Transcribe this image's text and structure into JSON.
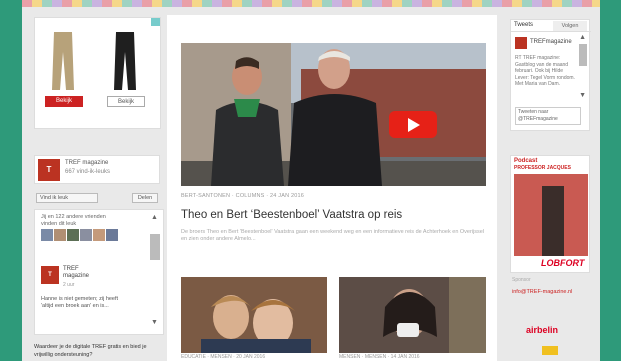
{
  "left": {
    "ad": {
      "products": [
        {
          "button": "Bekijk"
        },
        {
          "button": "Bekijk"
        }
      ]
    },
    "fb": {
      "name": "TREF magazine",
      "likes_text": "667 vind-ik-leuks"
    },
    "like_button": "Vind ik leuk",
    "share_button": "Delen",
    "fanbox": {
      "count_text": "Jij en 122 andere vrienden vinden dit leuk",
      "post_name": "TREF magazine",
      "post_time": "2 uur",
      "post_body": "Hanne is niet gemeten; zij heeft 'altijd een broek aan' en is..."
    },
    "question": "Waardeer je de digitale TREF gratis en bied je vrijwillig ondersteuning?"
  },
  "main": {
    "featured": {
      "meta": "BERT-SANTONEN · COLUMNS · 24 JAN 2016",
      "title": "Theo en Bert ‘Beestenboel’ Vaatstra op reis",
      "excerpt": "De broers Theo en Bert 'Beestenboel' Vaatstra gaan een weekend weg en een informatieve reis de Achterhoek en Overijssel en zien onder andere Almelo..."
    },
    "thumbs": [
      {
        "meta": "EDUCATIE · MENSEN · 20 JAN 2016"
      },
      {
        "meta": "MENSEN · MENSEN · 14 JAN 2016"
      }
    ]
  },
  "right": {
    "tabs": [
      "Tweets",
      "Volgen"
    ],
    "tweet_name": "TREFmagazine",
    "tweet_text": "RT TREF magazine: Gastblog van de maand februari. Ook bij Hilde Lever: Tegel Vorm rondom. Met Maria van Dam.",
    "tweet_box": "Tweeten naar @TREFmagazine",
    "podcast_title": "Podcast",
    "podcast_sub": "PROFESSOR JACQUES",
    "podcast_brand": "LOBFORT",
    "meta": "Sponsor",
    "link": "info@TREF-magazine.nl",
    "sponsor": "airbelin"
  }
}
